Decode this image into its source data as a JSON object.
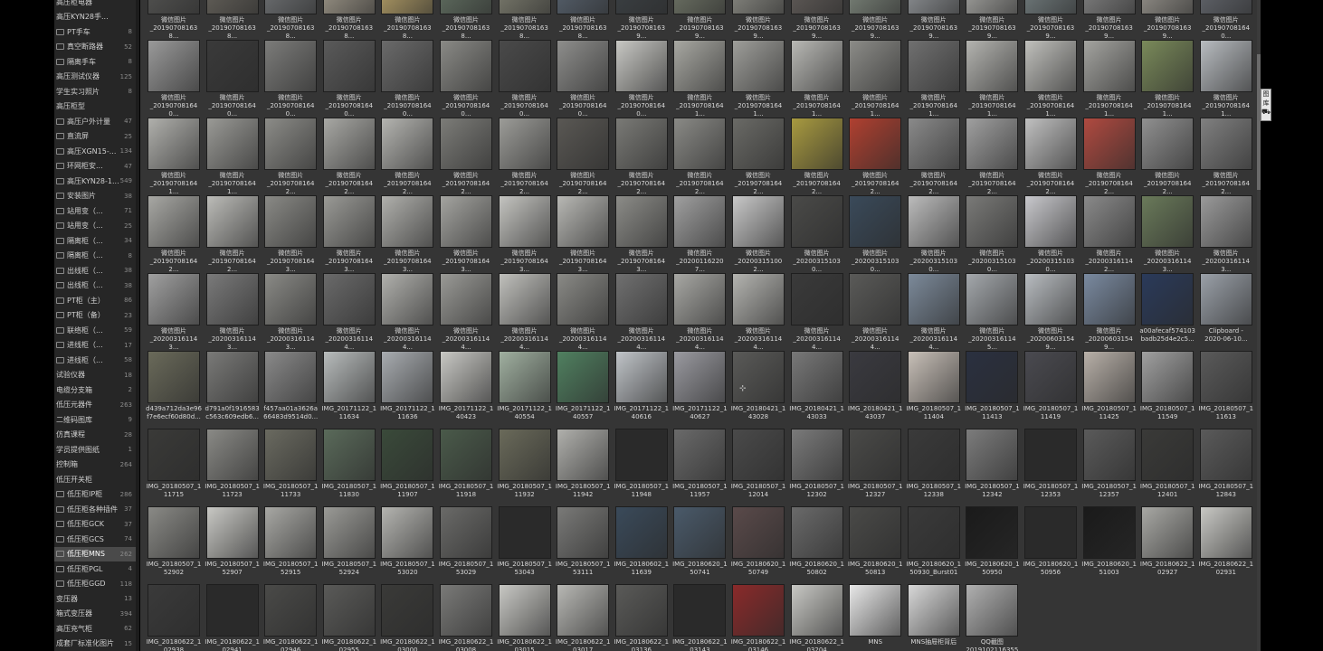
{
  "sidebar": {
    "items": [
      {
        "label": "高压柜电器",
        "count": "",
        "indent": 0
      },
      {
        "label": "高压KYN28手...",
        "count": "",
        "indent": 0
      },
      {
        "label": "PT手车",
        "count": "8",
        "indent": 1
      },
      {
        "label": "真空断路器",
        "count": "52",
        "indent": 1
      },
      {
        "label": "隔离手车",
        "count": "8",
        "indent": 1
      },
      {
        "label": "高压测试仪器",
        "count": "125",
        "indent": 0
      },
      {
        "label": "学生实习照片",
        "count": "8",
        "indent": 0
      },
      {
        "label": "高压柜型",
        "count": "",
        "indent": 0
      },
      {
        "label": "高压户外计量",
        "count": "47",
        "indent": 1
      },
      {
        "label": "直流屏",
        "count": "25",
        "indent": 1
      },
      {
        "label": "高压XGN15-...",
        "count": "134",
        "indent": 1
      },
      {
        "label": "环网柜安...",
        "count": "47",
        "indent": 1
      },
      {
        "label": "高压KYN28-1...",
        "count": "549",
        "indent": 1
      },
      {
        "label": "安装图片",
        "count": "38",
        "indent": 1
      },
      {
        "label": "站用变（...",
        "count": "71",
        "indent": 1
      },
      {
        "label": "站用变（...",
        "count": "25",
        "indent": 1
      },
      {
        "label": "隔离柜（...",
        "count": "34",
        "indent": 1
      },
      {
        "label": "隔离柜（...",
        "count": "8",
        "indent": 1
      },
      {
        "label": "出线柜（...",
        "count": "38",
        "indent": 1
      },
      {
        "label": "出线柜（...",
        "count": "38",
        "indent": 1
      },
      {
        "label": "PT柜（主）",
        "count": "86",
        "indent": 1
      },
      {
        "label": "PT柜（备）",
        "count": "23",
        "indent": 1
      },
      {
        "label": "联络柜（...",
        "count": "59",
        "indent": 1
      },
      {
        "label": "进线柜（...",
        "count": "17",
        "indent": 1
      },
      {
        "label": "进线柜（...",
        "count": "58",
        "indent": 1
      },
      {
        "label": "试验仪器",
        "count": "18",
        "indent": 0
      },
      {
        "label": "电缆分支箱",
        "count": "2",
        "indent": 0
      },
      {
        "label": "低压元器件",
        "count": "263",
        "indent": 0
      },
      {
        "label": "二维码图库",
        "count": "9",
        "indent": 0
      },
      {
        "label": "仿真课程",
        "count": "28",
        "indent": 0
      },
      {
        "label": "学员提供图纸",
        "count": "1",
        "indent": 0
      },
      {
        "label": "控制箱",
        "count": "264",
        "indent": 0
      },
      {
        "label": "低压开关柜",
        "count": "",
        "indent": 0
      },
      {
        "label": "低压柜IP柜",
        "count": "286",
        "indent": 1
      },
      {
        "label": "低压柜各种插件",
        "count": "37",
        "indent": 1
      },
      {
        "label": "低压柜GCK",
        "count": "37",
        "indent": 1
      },
      {
        "label": "低压柜GCS",
        "count": "74",
        "indent": 1
      },
      {
        "label": "低压柜MNS",
        "count": "262",
        "indent": 1,
        "selected": true
      },
      {
        "label": "低压柜PGL",
        "count": "4",
        "indent": 1
      },
      {
        "label": "低压柜GGD",
        "count": "118",
        "indent": 1
      },
      {
        "label": "变压器",
        "count": "13",
        "indent": 0
      },
      {
        "label": "箱式变压器",
        "count": "394",
        "indent": 0
      },
      {
        "label": "高压充气柜",
        "count": "62",
        "indent": 0
      },
      {
        "label": "成套厂标准化图片",
        "count": "15",
        "indent": 0
      }
    ]
  },
  "grid": {
    "rows": [
      {
        "lines": [
          "微信图片",
          "_201907081638..."
        ],
        "captions": [
          "_201907081638...",
          "_201907081638...",
          "_201907081638...",
          "_201907081638...",
          "_201907081638...",
          "_201907081638...",
          "_201907081638...",
          "_201907081638...",
          "_201907081639...",
          "_201907081639...",
          "_201907081639...",
          "_201907081639...",
          "_201907081639...",
          "_201907081639...",
          "_201907081639...",
          "_201907081639...",
          "_201907081639...",
          "_201907081639...",
          "_201907081640..."
        ],
        "colors": [
          "#5a5a58",
          "#6e6a62",
          "#7a7d80",
          "#b0a898",
          "#c8b070",
          "#6a7a6a",
          "#8a8a7a",
          "#5e6a78",
          "#3e4448",
          "#7a8070",
          "#9a9a92",
          "#6a6460",
          "#8a9488",
          "#a0a4a8",
          "#b8b8b4",
          "#7e8a8c",
          "#909090",
          "#a8a49c",
          "#6c7078"
        ]
      },
      {
        "line1": "微信图片",
        "captions": [
          "_201907081640...",
          "_201907081640...",
          "_201907081640...",
          "_201907081640...",
          "_201907081640...",
          "_201907081640...",
          "_201907081640...",
          "_201907081640...",
          "_201907081640...",
          "_201907081641...",
          "_201907081641...",
          "_201907081641...",
          "_201907081641...",
          "_201907081641...",
          "_201907081641...",
          "_201907081641...",
          "_201907081641...",
          "_201907081641...",
          "_201907081641..."
        ],
        "colors": [
          "#9a9a9a",
          "#3a3a3a",
          "#7c7c7a",
          "#5a5a5a",
          "#6a6a6a",
          "#8a8a86",
          "#4a4a4a",
          "#8e8e8c",
          "#c8c8c4",
          "#a8a8a2",
          "#9e9e9a",
          "#b8b8b4",
          "#8c8c88",
          "#707070",
          "#b4b4b0",
          "#c0c0bc",
          "#a4a4a0",
          "#7a8a5a",
          "#b8bcc0"
        ]
      },
      {
        "line1": "微信图片",
        "captions": [
          "_201907081641...",
          "_201907081641...",
          "_201907081642...",
          "_201907081642...",
          "_201907081642...",
          "_201907081642...",
          "_201907081642...",
          "_201907081642...",
          "_201907081642...",
          "_201907081642...",
          "_201907081642...",
          "_201907081642...",
          "_201907081642...",
          "_201907081642...",
          "_201907081642...",
          "_201907081642...",
          "_201907081642...",
          "_201907081642...",
          "_201907081642..."
        ],
        "colors": [
          "#b0b0ac",
          "#9a9a96",
          "#8c8c88",
          "#a8a8a4",
          "#b4b4b0",
          "#7c7c78",
          "#9c9c98",
          "#5a5854",
          "#7a7a76",
          "#8a8a86",
          "#6a6a66",
          "#a89a40",
          "#b04030",
          "#8a8a8a",
          "#a0a0a0",
          "#c0c0c0",
          "#b04a40",
          "#909090",
          "#808080"
        ]
      },
      {
        "line1": "微信图片",
        "captions": [
          "_201907081642...",
          "_201907081642...",
          "_201907081643...",
          "_201907081643...",
          "_201907081643...",
          "_201907081643...",
          "_201907081643...",
          "_201907081643...",
          "_201907081643...",
          "_202001162207...",
          "_202003151002...",
          "_202003151030...",
          "_202003151030...",
          "_202003151030...",
          "_202003151030...",
          "_202003151030...",
          "_202003161142...",
          "_202003161143...",
          "_202003161143..."
        ],
        "colors": [
          "#a8a8a4",
          "#bcbcb8",
          "#8a8a86",
          "#9a9a96",
          "#b0b0ac",
          "#a4a4a0",
          "#c4c4c0",
          "#b8b8b4",
          "#8c8c88",
          "#a0a0a0",
          "#c8c8c8",
          "#4a4a48",
          "#3a4a5a",
          "#bcbcbc",
          "#7a7a78",
          "#c8c8cc",
          "#8a8a8a",
          "#6a7a5a",
          "#9a9a9a"
        ]
      },
      {
        "line1": "微信图片",
        "captions": [
          "_202003161143...",
          "_202003161143...",
          "_202003161143...",
          "_202003161144...",
          "_202003161144...",
          "_202003161144...",
          "_202003161144...",
          "_202003161144...",
          "_202003161144...",
          "_202003161144...",
          "_202003161144...",
          "_202003161144...",
          "_202003161144...",
          "_202003161144...",
          "_202003161145...",
          "_202006031549...",
          "_202006031549...",
          "_202006031549...",
          "_202006031549..."
        ],
        "colors": [
          "#a0a0a0",
          "#7a7a7a",
          "#8a8a86",
          "#6a6a6a",
          "#b0b0ac",
          "#9a9a96",
          "#c0c0bc",
          "#8a8a86",
          "#707070",
          "#a8a8a4",
          "#b4b4b0",
          "#3a3a3a",
          "#5a5a58",
          "#7c8a9a",
          "#a4a8ac",
          "#b8bcc0",
          "#7a8aa0",
          "#2a3a5a",
          "#9aa0a8"
        ],
        "overrides": {
          "18": {
            "line1": "a00afecaf574103",
            "line2": "badb25d4e2c5..."
          },
          "19": {
            "line1": "Clipboard -",
            "line2": "2020-06-10..."
          }
        }
      },
      {
        "captions": [
          [
            "d439a712da3e96",
            "f7e6ecf60d80d..."
          ],
          [
            "d791a0f1916583",
            "c563c609edb6..."
          ],
          [
            "f457aa01a3626a",
            "66483d9514d0..."
          ],
          [
            "IMG_20171122_1",
            "11634"
          ],
          [
            "IMG_20171122_1",
            "11636"
          ],
          [
            "IMG_20171122_1",
            "40423"
          ],
          [
            "IMG_20171122_1",
            "40554"
          ],
          [
            "IMG_20171122_1",
            "40557"
          ],
          [
            "IMG_20171122_1",
            "40616"
          ],
          [
            "IMG_20171122_1",
            "40627"
          ],
          [
            "IMG_20180421_1",
            "43028"
          ],
          [
            "IMG_20180421_1",
            "43033"
          ],
          [
            "IMG_20180421_1",
            "43037"
          ],
          [
            "IMG_20180507_1",
            "11404"
          ],
          [
            "IMG_20180507_1",
            "11413"
          ],
          [
            "IMG_20180507_1",
            "11419"
          ],
          [
            "IMG_20180507_1",
            "11425"
          ],
          [
            "IMG_20180507_1",
            "11549"
          ],
          [
            "IMG_20180507_1",
            "11613"
          ]
        ],
        "colors": [
          "#6a6a5a",
          "#7a7a78",
          "#8a8a8a",
          "#b8bcbc",
          "#a8acb0",
          "#c8c8c4",
          "#a0b0a0",
          "#508060",
          "#c0c4c8",
          "#9a9aa0",
          "#5a5a58",
          "#787878",
          "#3a3a40",
          "#c8c0b8",
          "#2a3040",
          "#4a4a50",
          "#b8b0a8",
          "#a0a0a0",
          "#5a5a5a"
        ]
      },
      {
        "captions": [
          [
            "IMG_20180507_1",
            "11715"
          ],
          [
            "IMG_20180507_1",
            "11723"
          ],
          [
            "IMG_20180507_1",
            "11733"
          ],
          [
            "IMG_20180507_1",
            "11830"
          ],
          [
            "IMG_20180507_1",
            "11907"
          ],
          [
            "IMG_20180507_1",
            "11918"
          ],
          [
            "IMG_20180507_1",
            "11932"
          ],
          [
            "IMG_20180507_1",
            "11942"
          ],
          [
            "IMG_20180507_1",
            "11948"
          ],
          [
            "IMG_20180507_1",
            "11957"
          ],
          [
            "IMG_20180507_1",
            "12014"
          ],
          [
            "IMG_20180507_1",
            "12302"
          ],
          [
            "IMG_20180507_1",
            "12327"
          ],
          [
            "IMG_20180507_1",
            "12338"
          ],
          [
            "IMG_20180507_1",
            "12342"
          ],
          [
            "IMG_20180507_1",
            "12353"
          ],
          [
            "IMG_20180507_1",
            "12357"
          ],
          [
            "IMG_20180507_1",
            "12401"
          ],
          [
            "IMG_20180507_1",
            "12843"
          ]
        ],
        "colors": [
          "#3a3a38",
          "#8a8a86",
          "#6a6a60",
          "#5a6a5a",
          "#3a4a3a",
          "#4a5a4a",
          "#6a6a5a",
          "#b0b0ac",
          "#2a2a2a",
          "#6a6a6a",
          "#4a4a4a",
          "#7a7a7a",
          "#4a4a48",
          "#3a3a3a",
          "#7c7c7c",
          "#2a2a2a",
          "#5a5a5a",
          "#3a3a38",
          "#5a5a5a"
        ]
      },
      {
        "captions": [
          [
            "IMG_20180507_1",
            "52902"
          ],
          [
            "IMG_20180507_1",
            "52907"
          ],
          [
            "IMG_20180507_1",
            "52915"
          ],
          [
            "IMG_20180507_1",
            "52924"
          ],
          [
            "IMG_20180507_1",
            "53020"
          ],
          [
            "IMG_20180507_1",
            "53029"
          ],
          [
            "IMG_20180507_1",
            "53043"
          ],
          [
            "IMG_20180507_1",
            "53111"
          ],
          [
            "IMG_20180602_1",
            "11639"
          ],
          [
            "IMG_20180620_1",
            "50741"
          ],
          [
            "IMG_20180620_1",
            "50749"
          ],
          [
            "IMG_20180620_1",
            "50802"
          ],
          [
            "IMG_20180620_1",
            "50813"
          ],
          [
            "IMG_20180620_1",
            "50930_Burst01"
          ],
          [
            "IMG_20180620_1",
            "50950"
          ],
          [
            "IMG_20180620_1",
            "50956"
          ],
          [
            "IMG_20180620_1",
            "51003"
          ],
          [
            "IMG_20180622_1",
            "02927"
          ],
          [
            "IMG_20180622_1",
            "02931"
          ]
        ],
        "colors": [
          "#8a8a86",
          "#c8c8c4",
          "#a8a8a4",
          "#9a9a96",
          "#b4b4b0",
          "#6a6a68",
          "#2a2a2a",
          "#7a7a78",
          "#3a4a5a",
          "#4a5a6a",
          "#5a4a4a",
          "#6a6a6a",
          "#4a4a48",
          "#3a3a3a",
          "#1a1a1a",
          "#2a2a2a",
          "#1a1a1a",
          "#a8a8a4",
          "#c8c8c4"
        ]
      },
      {
        "captions": [
          [
            "IMG_20180622_1",
            "02938"
          ],
          [
            "IMG_20180622_1",
            "02941"
          ],
          [
            "IMG_20180622_1",
            "02946"
          ],
          [
            "IMG_20180622_1",
            "02955"
          ],
          [
            "IMG_20180622_1",
            "03000"
          ],
          [
            "IMG_20180622_1",
            "03008"
          ],
          [
            "IMG_20180622_1",
            "03015"
          ],
          [
            "IMG_20180622_1",
            "03017"
          ],
          [
            "IMG_20180622_1",
            "03136"
          ],
          [
            "IMG_20180622_1",
            "03143"
          ],
          [
            "IMG_20180622_1",
            "03146"
          ],
          [
            "IMG_20180622_1",
            "03204"
          ],
          [
            "MNS",
            ""
          ],
          [
            "MNS抽屉柜背后",
            ""
          ],
          [
            "QQ截图",
            "20191021163553"
          ]
        ],
        "colors": [
          "#3a3a3a",
          "#2a2a2a",
          "#4a4a48",
          "#5a5a58",
          "#3a3a38",
          "#7a7a78",
          "#c8c8c4",
          "#b8b8b4",
          "#5a5a58",
          "#2a2a2a",
          "#8a2a2a",
          "#c8c8c4",
          "#e8e8e8",
          "#d8d8d8",
          "#b0b0b0"
        ]
      }
    ]
  },
  "tooltip": {
    "text": "图库",
    "icon_name": "cart-icon",
    "glyph": "⛟"
  },
  "cursor": {
    "icon_name": "cursor-icon",
    "glyph": "⊹"
  }
}
